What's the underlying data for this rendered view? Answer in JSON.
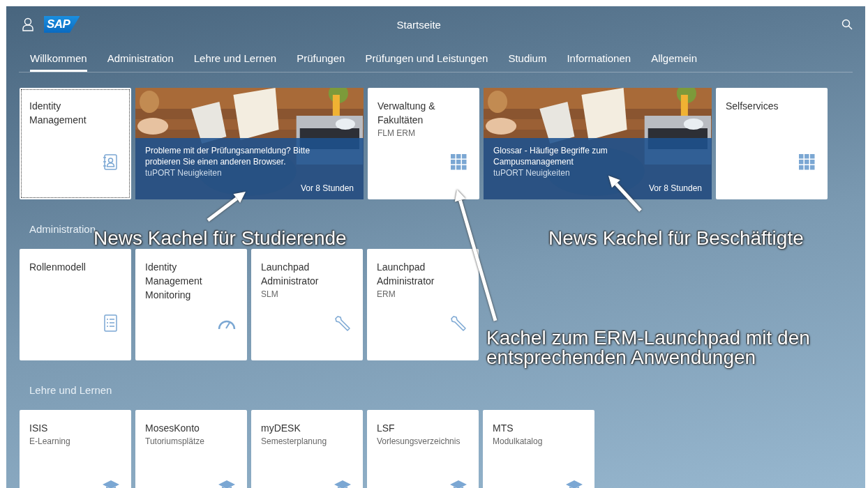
{
  "header": {
    "logo": "SAP",
    "title": "Startseite"
  },
  "tabs": [
    {
      "label": "Willkommen",
      "selected": true
    },
    {
      "label": "Administration",
      "selected": false
    },
    {
      "label": "Lehre und Lernen",
      "selected": false
    },
    {
      "label": "Prüfungen",
      "selected": false
    },
    {
      "label": "Prüfungen und Leistungen",
      "selected": false
    },
    {
      "label": "Studium",
      "selected": false
    },
    {
      "label": "Informationen",
      "selected": false
    },
    {
      "label": "Allgemein",
      "selected": false
    }
  ],
  "sections": [
    {
      "tiles": [
        {
          "kind": "app",
          "title": "Identity Management",
          "focused": true
        },
        {
          "kind": "news",
          "headline": "Probleme mit der Prüfungsanmeldung? Bitte probieren Sie einen anderen Browser.",
          "source": "tuPORT Neuigkeiten",
          "time": "Vor 8 Stunden"
        },
        {
          "kind": "app",
          "title": "Verwaltung & Fakultäten",
          "subtitle": "FLM ERM",
          "focused": false
        },
        {
          "kind": "news",
          "headline": "Glossar - Häufige Begriffe zum Campusmanagement",
          "source": "tuPORT Neuigkeiten",
          "time": "Vor 8 Stunden"
        },
        {
          "kind": "app",
          "title": "Selfservices",
          "focused": false
        }
      ]
    },
    {
      "title": "Administration",
      "tiles": [
        {
          "kind": "app",
          "title": "Rollenmodell",
          "focused": false
        },
        {
          "kind": "app",
          "title": "Identity Management Monitoring",
          "focused": false
        },
        {
          "kind": "app",
          "title": "Launchpad Administrator",
          "subtitle": "SLM",
          "focused": false
        },
        {
          "kind": "app",
          "title": "Launchpad Administrator",
          "subtitle": "ERM",
          "focused": false
        }
      ]
    },
    {
      "title": "Lehre und Lernen",
      "tiles": [
        {
          "kind": "app",
          "title": "ISIS",
          "subtitle": "E-Learning",
          "focused": false
        },
        {
          "kind": "app",
          "title": "MosesKonto",
          "subtitle": "Tutoriumsplätze",
          "focused": false
        },
        {
          "kind": "app",
          "title": "myDESK",
          "subtitle": "Semesterplanung",
          "focused": false
        },
        {
          "kind": "app",
          "title": "LSF",
          "subtitle": "Vorlesungsverzeichnis",
          "focused": false
        },
        {
          "kind": "app",
          "title": "MTS",
          "subtitle": "Modulkatalog",
          "focused": false
        }
      ]
    }
  ],
  "annotations": [
    {
      "text": "News Kachel für Studierende"
    },
    {
      "text": "News Kachel für Beschäftigte"
    },
    {
      "text": "Kachel zum ERM-Launchpad mit den entsprechenden Anwendungen"
    }
  ]
}
